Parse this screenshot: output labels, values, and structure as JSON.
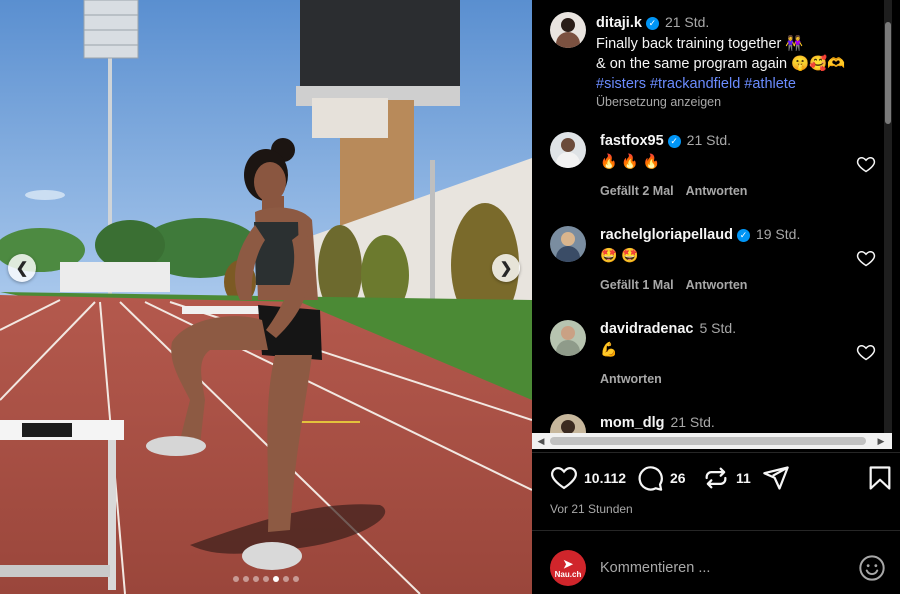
{
  "photo": {
    "prev_icon": "chevron-left-icon",
    "next_icon": "chevron-right-icon",
    "carousel_dots": 7,
    "active_dot": 4
  },
  "post": {
    "author": "ditaji.k",
    "time": "21 Std.",
    "caption_line1": "Finally back training together 👭",
    "caption_line2": "& on the same program again 🤫🥰🫶",
    "hashtags": "#sisters #trackandfield #athlete",
    "translate_link": "Übersetzung anzeigen"
  },
  "comments": [
    {
      "user": "fastfox95",
      "verified": true,
      "time": "21 Std.",
      "text": "🔥 🔥 🔥",
      "likes_label": "Gefällt 2 Mal",
      "reply_label": "Antworten"
    },
    {
      "user": "rachelgloriapellaud",
      "verified": true,
      "time": "19 Std.",
      "text": "🤩 🤩",
      "likes_label": "Gefällt 1 Mal",
      "reply_label": "Antworten"
    },
    {
      "user": "davidradenac",
      "verified": false,
      "time": "5 Std.",
      "text": "💪",
      "likes_label": "",
      "reply_label": "Antworten"
    },
    {
      "user": "mom_dlg",
      "verified": false,
      "time": "21 Std.",
      "text": "",
      "likes_label": "",
      "reply_label": ""
    }
  ],
  "actions": {
    "likes": "10.112",
    "comments": "26",
    "reposts": "11",
    "posted_ago": "Vor 21 Stunden"
  },
  "composer": {
    "placeholder": "Kommentieren ...",
    "avatar_line1": "Nau.ch",
    "emoji_icon": "smiley-icon"
  },
  "colors": {
    "background": "#000000",
    "link_blue": "#6b8cff",
    "verified_blue": "#0095f6",
    "muted_text": "#a8a8a8"
  }
}
